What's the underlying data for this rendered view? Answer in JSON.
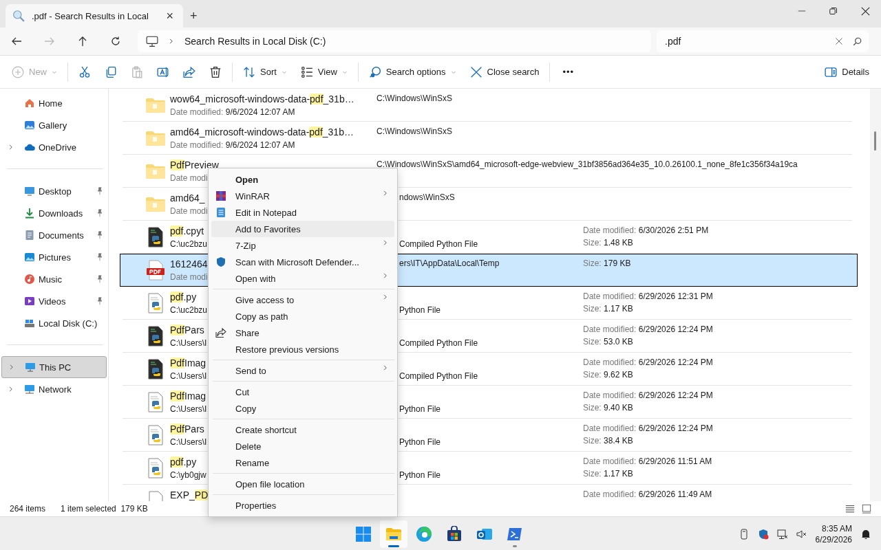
{
  "tab": {
    "title": ".pdf - Search Results in Local",
    "close": "×",
    "new_tab": "+"
  },
  "address": {
    "breadcrumb": "Search Results in Local Disk (C:)",
    "forward_disabled": true
  },
  "search": {
    "value": ".pdf"
  },
  "toolbar": [
    {
      "kind": "new",
      "label": "New",
      "disabled": true,
      "dropdown": true
    },
    {
      "kind": "separator"
    },
    {
      "kind": "cut",
      "disabled": false
    },
    {
      "kind": "copy",
      "disabled": false
    },
    {
      "kind": "paste",
      "disabled": true
    },
    {
      "kind": "rename",
      "disabled": false
    },
    {
      "kind": "share",
      "disabled": false
    },
    {
      "kind": "delete",
      "disabled": false
    },
    {
      "kind": "separator"
    },
    {
      "kind": "sort",
      "label": "Sort",
      "disabled": false,
      "dropdown": true
    },
    {
      "kind": "view",
      "label": "View",
      "disabled": false,
      "dropdown": true
    },
    {
      "kind": "separator"
    },
    {
      "kind": "search-options",
      "label": "Search options",
      "disabled": false,
      "dropdown": true
    },
    {
      "kind": "close",
      "label": "Close search",
      "disabled": false,
      "dropdown": false
    },
    {
      "kind": "separator"
    },
    {
      "kind": "more",
      "label": "•••"
    },
    {
      "kind": "spacer"
    },
    {
      "kind": "details",
      "label": "Details",
      "disabled": false,
      "dropdown": false
    }
  ],
  "sidebar": {
    "groups": [
      [
        {
          "kind": "home",
          "label": "Home",
          "expandable": false,
          "pinned": false,
          "selected": false
        },
        {
          "kind": "gallery",
          "label": "Gallery",
          "expandable": false,
          "pinned": false,
          "selected": false
        },
        {
          "kind": "cloud",
          "label": "OneDrive",
          "expandable": true,
          "pinned": false,
          "selected": false
        }
      ],
      [
        {
          "kind": "desktop",
          "label": "Desktop",
          "expandable": false,
          "pinned": true,
          "selected": false
        },
        {
          "kind": "download",
          "label": "Downloads",
          "expandable": false,
          "pinned": true,
          "selected": false
        },
        {
          "kind": "documents",
          "label": "Documents",
          "expandable": false,
          "pinned": true,
          "selected": false
        },
        {
          "kind": "pictures",
          "label": "Pictures",
          "expandable": false,
          "pinned": true,
          "selected": false
        },
        {
          "kind": "music",
          "label": "Music",
          "expandable": false,
          "pinned": true,
          "selected": false
        },
        {
          "kind": "videos",
          "label": "Videos",
          "expandable": false,
          "pinned": true,
          "selected": false
        },
        {
          "kind": "drive",
          "label": "Local Disk (C:)",
          "expandable": false,
          "pinned": false,
          "selected": false
        }
      ],
      [
        {
          "kind": "pc",
          "label": "This PC",
          "expandable": true,
          "pinned": false,
          "selected": true
        },
        {
          "kind": "network",
          "label": "Network",
          "expandable": true,
          "pinned": false,
          "selected": false
        }
      ]
    ]
  },
  "files": [
    {
      "kind": "folder",
      "selected": false,
      "name": [
        {
          "text": "wow64_microsoft-windows-data-",
          "match": false
        },
        {
          "text": "pdf",
          "match": true
        },
        {
          "text": "_31b…",
          "match": false
        }
      ],
      "detail_label": "Date modified:",
      "detail_value": "9/6/2024 12:07 AM",
      "column_2": "C:\\Windows\\WinSxS"
    },
    {
      "kind": "folder",
      "selected": false,
      "name": [
        {
          "text": "amd64_microsoft-windows-data-",
          "match": false
        },
        {
          "text": "pdf",
          "match": true
        },
        {
          "text": "_31b…",
          "match": false
        }
      ],
      "detail_label": "Date modified:",
      "detail_value": "9/6/2024 12:07 AM",
      "column_2": "C:\\Windows\\WinSxS"
    },
    {
      "kind": "folder",
      "selected": false,
      "name": [
        {
          "text": "Pdf",
          "match": true
        },
        {
          "text": "Preview",
          "match": false
        }
      ],
      "detail_label": "Date modi",
      "column_2": "C:\\Windows\\WinSxS\\amd64_microsoft-edge-webview_31bf3856ad364e35_10.0.26100.1_none_8fe1c356f34a19ca"
    },
    {
      "kind": "folder",
      "selected": false,
      "name": [
        {
          "text": "amd64_",
          "match": false
        }
      ],
      "detail_label": "Date modi",
      "column_2": "ndows\\WinSxS"
    },
    {
      "kind": "compiled",
      "selected": false,
      "name": [
        {
          "text": "pdf",
          "match": true
        },
        {
          "text": ".cpyt",
          "match": false
        }
      ],
      "detail_value": "C:\\uc2bzu",
      "column_2": "Compiled Python File",
      "modified_label": "Date modified:",
      "modified": "6/30/2026 2:51 PM",
      "size_label": "Size:",
      "size": "1.48 KB"
    },
    {
      "kind": "pdf",
      "selected": true,
      "name": [
        {
          "text": "1612464",
          "match": false
        }
      ],
      "detail_label": "Date modi",
      "column_2": "ers\\IT\\AppData\\Local\\Temp",
      "size_label": "Size:",
      "size": "179 KB"
    },
    {
      "kind": "python",
      "selected": false,
      "name": [
        {
          "text": "pdf",
          "match": true
        },
        {
          "text": ".py",
          "match": false
        }
      ],
      "detail_value": "C:\\uc2bzu",
      "column_2": "Python File",
      "modified_label": "Date modified:",
      "modified": "6/29/2026 12:31 PM",
      "size_label": "Size:",
      "size": "1.17 KB"
    },
    {
      "kind": "compiled",
      "selected": false,
      "name": [
        {
          "text": "Pdf",
          "match": true
        },
        {
          "text": "Pars",
          "match": false
        }
      ],
      "detail_value": "C:\\Users\\I",
      "column_2": "Compiled Python File",
      "modified_label": "Date modified:",
      "modified": "6/29/2026 12:24 PM",
      "size_label": "Size:",
      "size": "53.0 KB"
    },
    {
      "kind": "compiled",
      "selected": false,
      "name": [
        {
          "text": "Pdf",
          "match": true
        },
        {
          "text": "Imag",
          "match": false
        }
      ],
      "detail_value": "C:\\Users\\I",
      "column_2": "Compiled Python File",
      "modified_label": "Date modified:",
      "modified": "6/29/2026 12:24 PM",
      "size_label": "Size:",
      "size": "9.62 KB"
    },
    {
      "kind": "python",
      "selected": false,
      "name": [
        {
          "text": "Pdf",
          "match": true
        },
        {
          "text": "Imag",
          "match": false
        }
      ],
      "detail_value": "C:\\Users\\I",
      "column_2": "Python File",
      "modified_label": "Date modified:",
      "modified": "6/29/2026 12:24 PM",
      "size_label": "Size:",
      "size": "9.40 KB"
    },
    {
      "kind": "python",
      "selected": false,
      "name": [
        {
          "text": "Pdf",
          "match": true
        },
        {
          "text": "Pars",
          "match": false
        }
      ],
      "detail_value": "C:\\Users\\I",
      "column_2": "Python File",
      "modified_label": "Date modified:",
      "modified": "6/29/2026 12:24 PM",
      "size_label": "Size:",
      "size": "38.4 KB"
    },
    {
      "kind": "python",
      "selected": false,
      "name": [
        {
          "text": "pdf",
          "match": true
        },
        {
          "text": ".py",
          "match": false
        }
      ],
      "detail_value": "C:\\yb0gjw",
      "column_2": "Python File",
      "modified_label": "Date modified:",
      "modified": "6/29/2026 11:51 AM",
      "size_label": "Size:",
      "size": "1.17 KB"
    },
    {
      "kind": "generic",
      "selected": false,
      "name": [
        {
          "text": "EXP_",
          "match": false
        },
        {
          "text": "PD",
          "match": true
        }
      ],
      "modified_label": "Date modified:",
      "modified": "6/29/2026 11:49 AM"
    }
  ],
  "context_menu": [
    {
      "kind": "plain",
      "label": "Open",
      "default": true,
      "submenu": false,
      "highlighted": false
    },
    {
      "kind": "archive",
      "label": "WinRAR",
      "default": false,
      "submenu": true,
      "highlighted": false
    },
    {
      "kind": "notepad",
      "label": "Edit in Notepad",
      "default": false,
      "submenu": false,
      "highlighted": false
    },
    {
      "kind": "plain",
      "label": "Add to Favorites",
      "default": false,
      "submenu": false,
      "highlighted": true
    },
    {
      "kind": "plain",
      "label": "7-Zip",
      "default": false,
      "submenu": true,
      "highlighted": false
    },
    {
      "kind": "shield",
      "label": "Scan with Microsoft Defender...",
      "default": false,
      "submenu": false,
      "highlighted": false
    },
    {
      "kind": "plain",
      "label": "Open with",
      "default": false,
      "submenu": true,
      "highlighted": false
    },
    {
      "kind": "separator"
    },
    {
      "kind": "plain",
      "label": "Give access to",
      "default": false,
      "submenu": true,
      "highlighted": false
    },
    {
      "kind": "plain",
      "label": "Copy as path",
      "default": false,
      "submenu": false,
      "highlighted": false
    },
    {
      "kind": "share",
      "label": "Share",
      "default": false,
      "submenu": false,
      "highlighted": false
    },
    {
      "kind": "plain",
      "label": "Restore previous versions",
      "default": false,
      "submenu": false,
      "highlighted": false
    },
    {
      "kind": "separator"
    },
    {
      "kind": "plain",
      "label": "Send to",
      "default": false,
      "submenu": true,
      "highlighted": false
    },
    {
      "kind": "separator"
    },
    {
      "kind": "plain",
      "label": "Cut",
      "default": false,
      "submenu": false,
      "highlighted": false
    },
    {
      "kind": "plain",
      "label": "Copy",
      "default": false,
      "submenu": false,
      "highlighted": false
    },
    {
      "kind": "separator"
    },
    {
      "kind": "plain",
      "label": "Create shortcut",
      "default": false,
      "submenu": false,
      "highlighted": false
    },
    {
      "kind": "plain",
      "label": "Delete",
      "default": false,
      "submenu": false,
      "highlighted": false
    },
    {
      "kind": "plain",
      "label": "Rename",
      "default": false,
      "submenu": false,
      "highlighted": false
    },
    {
      "kind": "separator"
    },
    {
      "kind": "plain",
      "label": "Open file location",
      "default": false,
      "submenu": false,
      "highlighted": false
    },
    {
      "kind": "separator"
    },
    {
      "kind": "plain",
      "label": "Properties",
      "default": false,
      "submenu": false,
      "highlighted": false
    }
  ],
  "status_bar": {
    "items": "264 items",
    "selection": "1 item selected",
    "size": "179 KB"
  },
  "taskbar": {
    "apps": [
      {
        "kind": "start",
        "active": false,
        "running": false
      },
      {
        "kind": "explorer",
        "active": true,
        "running": true
      },
      {
        "kind": "edge",
        "active": false,
        "running": false
      },
      {
        "kind": "store",
        "active": false,
        "running": false
      },
      {
        "kind": "outlook",
        "active": false,
        "running": false
      },
      {
        "kind": "terminal",
        "active": false,
        "running": true
      }
    ],
    "time": "8:35 AM",
    "date": "6/29/2026"
  }
}
